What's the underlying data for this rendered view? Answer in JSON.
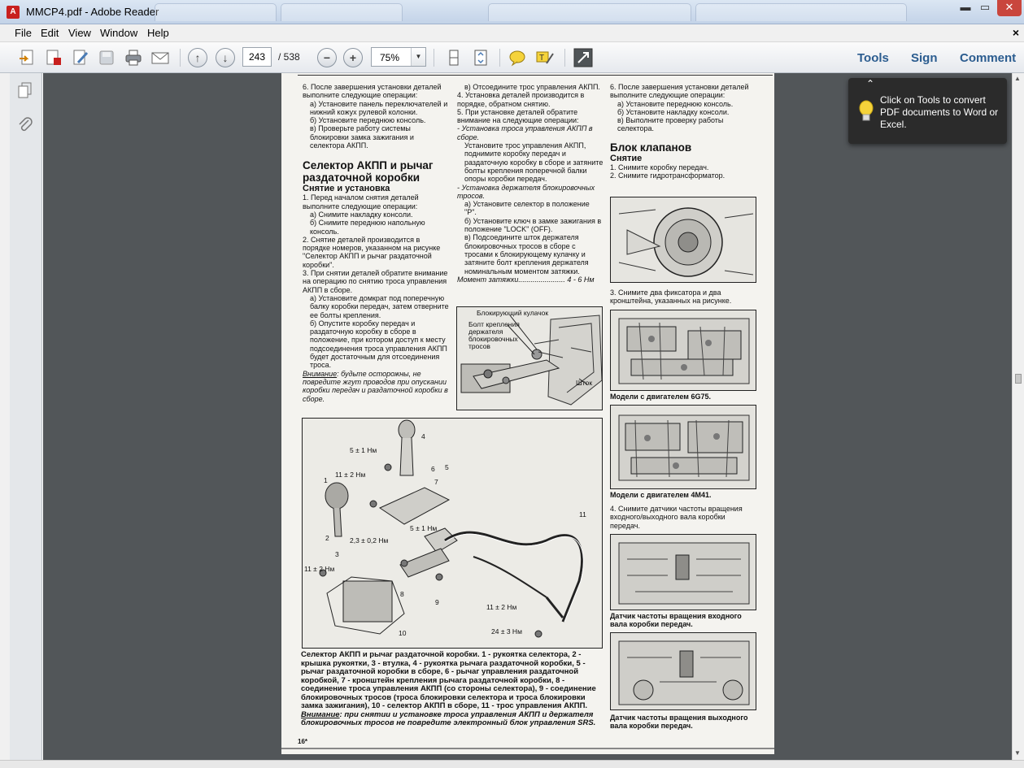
{
  "window": {
    "title": "MMCP4.pdf - Adobe Reader",
    "app_icon_letter": "A",
    "controls": {
      "minimize": "▬",
      "maximize": "▭",
      "close": "✕"
    }
  },
  "menu": {
    "items": [
      "File",
      "Edit",
      "View",
      "Window",
      "Help"
    ],
    "close": "×"
  },
  "toolbar": {
    "page_current": "243",
    "page_total": "/ 538",
    "zoom": "75%",
    "zoom_out": "−",
    "zoom_in": "+",
    "tools_label": "Tools",
    "sign_label": "Sign",
    "comment_label": "Comment"
  },
  "tooltip": {
    "text": "Click on Tools to convert PDF documents to Word or Excel.",
    "collapse": "⌃"
  },
  "pdf": {
    "col1": {
      "p1": "6. После завершения установки деталей выполните следующие операции:",
      "p2": "а) Установите панель переключателей и нижний кожух рулевой колонки.",
      "p3": "б) Установите переднюю консоль.",
      "p4": "в) Проверьте работу системы блокировки замка зажигания и селектора АКПП.",
      "h2": "Селектор АКПП и рычаг раздаточной коробки",
      "h3": "Снятие и установка",
      "p5": "1. Перед началом снятия деталей выполните следующие операции:",
      "p6": "а) Снимите накладку консоли.",
      "p7": "б) Снимите переднюю напольную консоль.",
      "p8": "2. Снятие деталей производится в порядке номеров, указанном на рисунке \"Селектор АКПП и рычаг раздаточной коробки\".",
      "p9": "3. При снятии деталей обратите внимание на операцию по снятию троса управления АКПП в сборе.",
      "p10": "а) Установите домкрат под поперечную балку коробки передач, затем отверните ее болты крепления.",
      "p11": "б) Опустите коробку передач и раздаточную коробку в сборе в положение, при котором доступ к месту подсоединения троса управления АКПП будет достаточным для отсоединения троса.",
      "p12_b": "Внимание",
      "p12": ": будьте осторожны, не повредите жгут проводов при опускании коробки передач и раздаточной коробки в сборе."
    },
    "col2": {
      "p1": "в) Отсоедините трос управления АКПП.",
      "p2": "4. Установка деталей производится в порядке, обратном снятию.",
      "p3": "5. При установке деталей обратите внимание на следующие операции:",
      "p4": "- Установка троса управления АКПП в сборе.",
      "p5": "Установите трос управления АКПП, поднимите коробку передач и раздаточную коробку в сборе и затяните болты крепления поперечной балки опоры коробки передач.",
      "p6": "- Установка держателя блокировочных тросов.",
      "p7": "а) Установите селектор в положение \"P\".",
      "p8": "б) Установите ключ в замке зажигания в положение \"LOCK\" (OFF).",
      "p9": "в) Подсоедините шток держателя блокировочных тросов в сборе с тросами к блокирующему кулачку и затяните болт крепления держателя номинальным моментом затяжки.",
      "p10": "Момент затяжки",
      "p10_val": "....................... 4 - 6 Нм",
      "fig_labels": {
        "cam": "Блокирующий кулачок",
        "bolt": "Болт крепления держателя блокировочных тросов",
        "rod": "Шток"
      }
    },
    "col3": {
      "p1": "6. После завершения установки деталей выполните следующие операции:",
      "p2": "а) Установите переднюю консоль.",
      "p3": "б) Установите накладку консоли.",
      "p4": "в) Выполните проверку работы селектора.",
      "h2": "Блок клапанов",
      "h3": "Снятие",
      "p5": "1. Снимите коробку передач.",
      "p6": "2. Снимите гидротрансформатор.",
      "p7": "3. Снимите два фиксатора и два кронштейна, указанных на рисунке.",
      "cap1": "Модели с двигателем 6G75.",
      "cap2": "Модели с двигателем 4M41.",
      "p8": "4. Снимите датчики частоты вращения входного/выходного вала коробки передач.",
      "cap3": "Датчик частоты вращения входного вала коробки передач.",
      "cap4": "Датчик частоты вращения выходного вала коробки передач."
    },
    "big_fig": {
      "labels": [
        "5 ± 1 Нм",
        "11 ± 2 Нм",
        "2,3 ± 0,2 Нм",
        "5 ± 1 Нм",
        "11 ± 2 Нм",
        "11 ± 2 Нм",
        "24 ± 3 Нм"
      ],
      "numbers": [
        "1",
        "2",
        "3",
        "4",
        "5",
        "6",
        "7",
        "8",
        "9",
        "10",
        "11"
      ]
    },
    "main_caption": "Селектор АКПП и рычаг раздаточной коробки. 1 - рукоятка селектора, 2 - крышка рукоятки, 3 - втулка, 4 - рукоятка рычага раздаточной коробки, 5 - рычаг раздаточной коробки в сборе, 6 - рычаг управления раздаточной коробкой, 7 - кронштейн крепления рычага раздаточной коробки, 8 - соединение троса управления АКПП (со стороны селектора), 9 - соединение блокировочных тросов (троса блокировки селектора и троса блокировки замка зажигания), 10 - селектор АКПП в сборе, 11 - трос управления АКПП.",
    "main_caption_warn_b": "Внимание",
    "main_caption_warn": ": при снятии и установке троса управления АКПП и держателя блокировочных тросов не повредите электронный блок управления SRS.",
    "page_no": "16*"
  }
}
